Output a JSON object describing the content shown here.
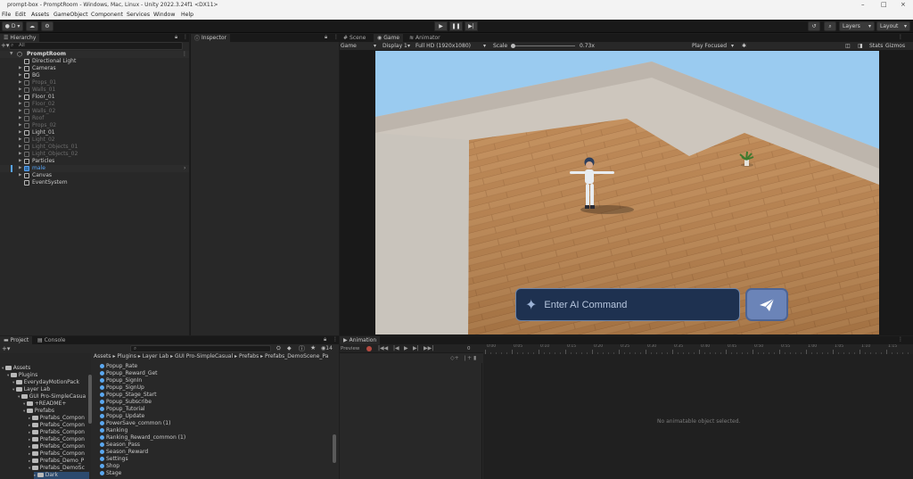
{
  "window": {
    "title": "prompt-box - PromptRoom - Windows, Mac, Linux - Unity 2022.3.24f1 <DX11>",
    "controls": [
      "–",
      "□",
      "×"
    ]
  },
  "menu": [
    "File",
    "Edit",
    "Assets",
    "GameObject",
    "Component",
    "Services",
    "Window",
    "Help"
  ],
  "toolbar": {
    "account": "D ▾",
    "layers": "Layers",
    "layout": "Layout"
  },
  "hierarchy": {
    "tab": "Hierarchy",
    "search_placeholder": "All",
    "scene": "PromptRoom",
    "items": [
      {
        "label": "Directional Light",
        "style": "normal",
        "arrow": ""
      },
      {
        "label": "Cameras",
        "style": "normal",
        "arrow": "▶"
      },
      {
        "label": "BG",
        "style": "normal",
        "arrow": "▶"
      },
      {
        "label": "Props_01",
        "style": "dim",
        "arrow": "▶"
      },
      {
        "label": "Walls_01",
        "style": "dim",
        "arrow": "▶"
      },
      {
        "label": "Floor_01",
        "style": "normal",
        "arrow": "▶"
      },
      {
        "label": "Floor_02",
        "style": "dim",
        "arrow": "▶"
      },
      {
        "label": "Walls_02",
        "style": "dim",
        "arrow": "▶"
      },
      {
        "label": "Roof",
        "style": "dim",
        "arrow": "▶"
      },
      {
        "label": "Props_02",
        "style": "dim",
        "arrow": "▶"
      },
      {
        "label": "Light_01",
        "style": "normal",
        "arrow": "▶"
      },
      {
        "label": "Light_02",
        "style": "dim",
        "arrow": "▶"
      },
      {
        "label": "Light_Objects_01",
        "style": "dim",
        "arrow": "▶"
      },
      {
        "label": "Light_Objects_02",
        "style": "dim",
        "arrow": "▶"
      },
      {
        "label": "Particles",
        "style": "normal",
        "arrow": "▶"
      },
      {
        "label": "male",
        "style": "blue",
        "arrow": "▶"
      },
      {
        "label": "Canvas",
        "style": "normal",
        "arrow": "▶"
      },
      {
        "label": "EventSystem",
        "style": "normal",
        "arrow": ""
      }
    ]
  },
  "inspector": {
    "tab": "Inspector"
  },
  "game": {
    "tabs": [
      "Scene",
      "Game",
      "Animator"
    ],
    "display_mode": "Game",
    "display": "Display 1",
    "resolution": "Full HD (1920x1080)",
    "scale_label": "Scale",
    "scale_value": "0.73x",
    "play_mode": "Play Focused",
    "stats": "Stats",
    "gizmos": "Gizmos",
    "prompt_placeholder": "Enter AI Command"
  },
  "project": {
    "tabs": [
      "Project",
      "Console"
    ],
    "search_placeholder": "",
    "item_count": "14",
    "breadcrumb": [
      "Assets",
      "Plugins",
      "Layer Lab",
      "GUI Pro-SimpleCasual",
      "Prefabs",
      "Prefabs_DemoScene_Pa"
    ],
    "tree": [
      {
        "label": "Assets",
        "indent": 0
      },
      {
        "label": "Plugins",
        "indent": 1
      },
      {
        "label": "EverydayMotionPack",
        "indent": 2
      },
      {
        "label": "Layer Lab",
        "indent": 2
      },
      {
        "label": "GUI Pro-SimpleCasua",
        "indent": 3
      },
      {
        "label": "+README+",
        "indent": 4
      },
      {
        "label": "Prefabs",
        "indent": 4
      },
      {
        "label": "Prefabs_Compon",
        "indent": 5
      },
      {
        "label": "Prefabs_Compon",
        "indent": 5
      },
      {
        "label": "Prefabs_Compon",
        "indent": 5
      },
      {
        "label": "Prefabs_Compon",
        "indent": 5
      },
      {
        "label": "Prefabs_Compon",
        "indent": 5
      },
      {
        "label": "Prefabs_Compon",
        "indent": 5
      },
      {
        "label": "Prefabs_Demo_P",
        "indent": 5
      },
      {
        "label": "Prefabs_DemoSc",
        "indent": 5
      },
      {
        "label": "Dark",
        "indent": 6
      }
    ],
    "files": [
      "Popup_Rate",
      "Popup_Reward_Get",
      "Popup_SignIn",
      "Popup_SignUp",
      "Popup_Stage_Start",
      "Popup_Subscribe",
      "Popup_Tutorial",
      "Popup_Update",
      "PowerSave_common (1)",
      "Ranking",
      "Ranking_Reward_common (1)",
      "Season_Pass",
      "Season_Reward",
      "Settings",
      "Shop",
      "Stage"
    ]
  },
  "animation": {
    "tab": "Animation",
    "preview": "Preview",
    "frame": "0",
    "ticks": [
      "0:00",
      "0:05",
      "0:10",
      "0:15",
      "0:20",
      "0:25",
      "0:30",
      "0:35",
      "0:40",
      "0:45",
      "0:50",
      "0:55",
      "1:00",
      "1:05",
      "1:10",
      "1:15",
      "1:20",
      "1:25"
    ],
    "empty_message": "No animatable object selected."
  }
}
